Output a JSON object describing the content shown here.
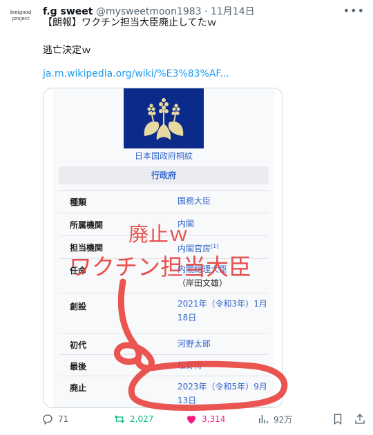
{
  "tweet": {
    "avatar_line1": "feelgood",
    "avatar_line2": "project",
    "name": "f.g sweet",
    "handle": "@mysweetmoon1983",
    "dot": "·",
    "date": "11月14日",
    "line1": "【朗報】ワクチン担当大臣廃止してたｗ",
    "line2": "逃亡決定ｗ",
    "link": "ja.m.wikipedia.org/wiki/%E3%83%AF..."
  },
  "infobox": {
    "emblem_caption": "日本国政府桐紋",
    "header": "行政府",
    "rows": [
      {
        "key": "種類",
        "value": "国務大臣"
      },
      {
        "key": "所属機関",
        "value": "内閣"
      },
      {
        "key": "担当機関",
        "value": "内閣官房",
        "sup": "[1]"
      },
      {
        "key": "任命",
        "value": "内閣総理大臣",
        "value2": "（岸田文雄）"
      },
      {
        "key": "創設",
        "value_a": "2021年（令和3年）",
        "value_b": "1月18日"
      },
      {
        "key": "初代",
        "value": "河野太郎"
      },
      {
        "key": "最後",
        "value": "松野博一"
      },
      {
        "key": "廃止",
        "value_a": "2023年（令和5年）",
        "value_b": "9月13日"
      }
    ]
  },
  "overlay": {
    "line1": "廃止ｗ",
    "line2": "ワクチン担当大臣",
    "color": "#e8423f"
  },
  "actions": {
    "replies": "71",
    "retweets": "2,027",
    "likes": "3,314",
    "views": "92万"
  },
  "colors": {
    "link": "#1d9bf0",
    "retweet": "#00ba7c",
    "like": "#f91880",
    "flag": "#0b2b8a"
  }
}
